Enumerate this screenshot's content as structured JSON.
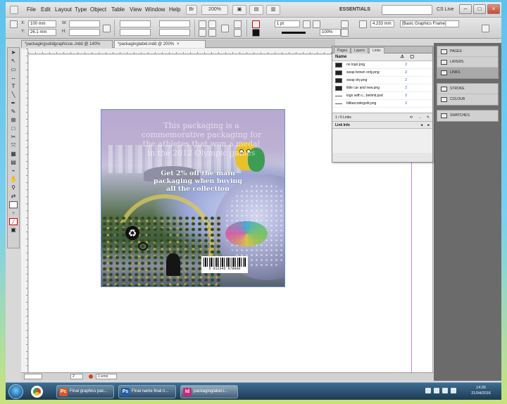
{
  "menubar": {
    "items": [
      "File",
      "Edit",
      "Layout",
      "Type",
      "Object",
      "Table",
      "View",
      "Window",
      "Help"
    ],
    "zoom": "200%",
    "workspace": "ESSENTIALS",
    "search_placeholder": "",
    "cs_live": "CS Live"
  },
  "control": {
    "x_label": "X:",
    "x_value": "100 mm",
    "y_label": "Y:",
    "y_value": "26.1 mm",
    "w_label": "W:",
    "h_label": "H:",
    "stroke_weight": "1 pt",
    "percent_w": "100%",
    "percent_h": "100%",
    "offset": "4.233 mm",
    "frame_style": "[Basic Graphics Frame]"
  },
  "doc_tabs": [
    {
      "label": "*packagingsolidgraphicse..indd @ 140%",
      "active": false
    },
    {
      "label": "*packaginglabel.indd @ 200%",
      "active": true
    }
  ],
  "artwork": {
    "headline": "This packaging is a commemorative packaging for the athletes that won a medal in the 2012 Olympic games",
    "offer": "Get 2% off the main packaging when buying all the collection",
    "barcode_number": "5 012345 678900"
  },
  "links_panel": {
    "tabs": [
      "Pages",
      "Layers",
      "Links"
    ],
    "active_tab": "Links",
    "column_name": "Name",
    "links": [
      {
        "name": "no logo.png",
        "page": "2"
      },
      {
        "name": "swap brown only.png",
        "page": "2"
      },
      {
        "name": "swap dry.png",
        "page": "2"
      },
      {
        "name": "little car and new.png",
        "page": "2"
      },
      {
        "name": "logo with c...belimit.psd",
        "page": "2"
      },
      {
        "name": "bilbarcodegold.png",
        "page": "2"
      }
    ],
    "count": "1 / 6 Links",
    "link_info": "Link Info"
  },
  "dock": {
    "group1": [
      "PAGES",
      "LAYERS",
      "LINKS"
    ],
    "group2": [
      "STROKE",
      "COLOUR"
    ],
    "group3": [
      "SWATCHES"
    ],
    "selected": "LINKS"
  },
  "statusbar": {
    "page": "2",
    "errors": "1 error"
  },
  "taskbar": {
    "buttons": [
      {
        "label": "Final graphics pac...",
        "icon": "Pc",
        "color": "#d9572a"
      },
      {
        "label": "Final name final n...",
        "icon": "Ps",
        "color": "#1f5fa8"
      },
      {
        "label": "packaginglabel.i...",
        "icon": "Id",
        "color": "#c22a7b"
      }
    ],
    "time": "14:26",
    "date": "21/04/2016"
  }
}
